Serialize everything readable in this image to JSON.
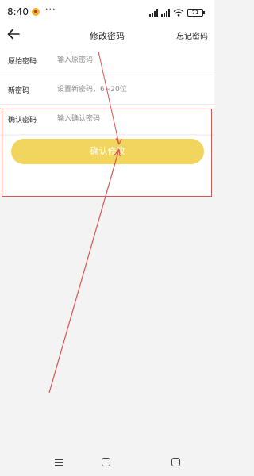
{
  "status_bar": {
    "time": "8:40",
    "more": "···",
    "battery": "71",
    "app_icon": "app-notification-icon"
  },
  "header": {
    "title": "修改密码",
    "forgot_label": "忘记密码",
    "back_icon": "arrow-left-icon"
  },
  "form": {
    "fields": [
      {
        "label": "原始密码",
        "placeholder": "输入原密码",
        "value": ""
      },
      {
        "label": "新密码",
        "placeholder": "设置新密码，6~20位",
        "value": ""
      },
      {
        "label": "确认密码",
        "placeholder": "输入确认密码",
        "value": ""
      }
    ],
    "confirm_label": "确认修改"
  },
  "colors": {
    "accent": "#f2d55e",
    "highlight": "#d9534f",
    "background": "#f3f3f3"
  },
  "nav": {
    "menu_icon": "menu-icon",
    "home_icon": "home-square-icon",
    "back_icon": "back-square-icon"
  }
}
